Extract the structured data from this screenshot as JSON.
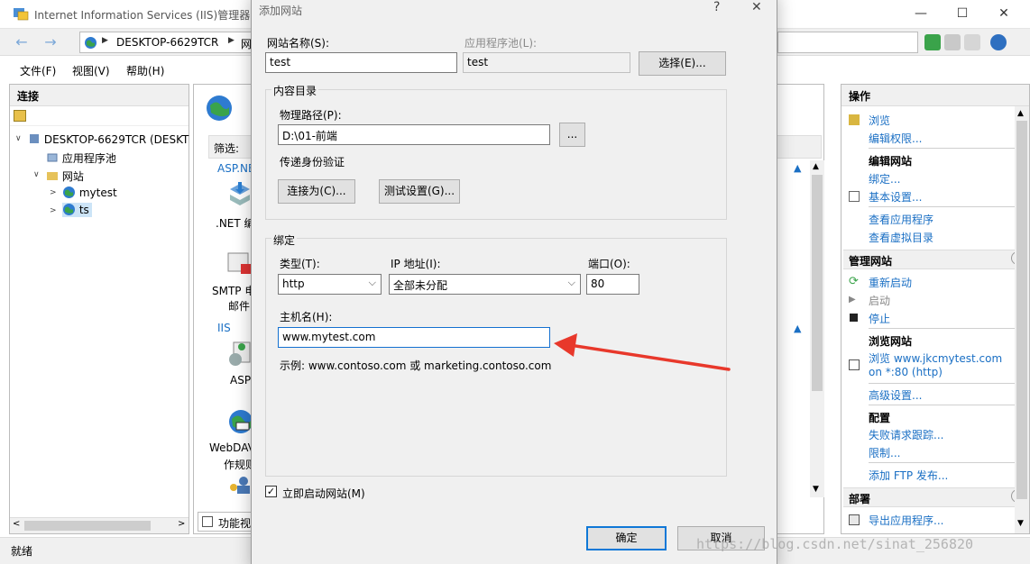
{
  "window": {
    "title": "Internet Information Services (IIS)管理器",
    "minimize": "—",
    "maximize": "☐",
    "close": "✕"
  },
  "address": {
    "back": "←",
    "forward": "→",
    "crumb_host": "DESKTOP-6629TCR",
    "crumb_sep": "▶",
    "crumb_next": "网"
  },
  "menu": {
    "file": "文件(F)",
    "view": "视图(V)",
    "help": "帮助(H)"
  },
  "connections": {
    "header": "连接",
    "tree": [
      {
        "label": "DESKTOP-6629TCR (DESKT",
        "twisty": "∨"
      },
      {
        "label": "应用程序池",
        "twisty": ""
      },
      {
        "label": "网站",
        "twisty": "∨"
      },
      {
        "label": "mytest",
        "twisty": ">"
      },
      {
        "label": "ts",
        "twisty": ">"
      }
    ]
  },
  "center": {
    "filter_label": "筛选:",
    "group_asp": "ASP.NE",
    "item_net": ".NET 编",
    "item_smtp": "SMTP 电",
    "item_smtp2": "邮件",
    "group_iis": "IIS",
    "item_asp": "ASP",
    "item_webdav": "WebDAV",
    "item_webdav2": "作规则",
    "bottom_tab": "功能视"
  },
  "actions": {
    "header": "操作",
    "browse": "浏览",
    "edit_perms": "编辑权限...",
    "edit_site": "编辑网站",
    "bindings": "绑定...",
    "basic_settings": "基本设置...",
    "view_apps": "查看应用程序",
    "view_vdirs": "查看虚拟目录",
    "manage_site": "管理网站",
    "restart": "重新启动",
    "start": "启动",
    "stop": "停止",
    "browse_site": "浏览网站",
    "browse_url": "浏览 www.jkcmytest.com",
    "browse_port": "on *:80 (http)",
    "advanced": "高级设置...",
    "config": "配置",
    "failed_trace": "失败请求跟踪...",
    "limits": "限制...",
    "add_ftp": "添加 FTP 发布...",
    "deploy": "部署",
    "export_app": "导出应用程序...",
    "collapse": "⌃"
  },
  "dialog": {
    "title": "添加网站",
    "help": "?",
    "close": "✕",
    "site_name_label": "网站名称(S):",
    "site_name_value": "test",
    "app_pool_label": "应用程序池(L):",
    "app_pool_value": "test",
    "select_button": "选择(E)...",
    "content_dir_title": "内容目录",
    "physical_path_label": "物理路径(P):",
    "physical_path_value": "D:\\01-前端",
    "browse_button": "...",
    "pass_through_label": "传递身份验证",
    "connect_as_button": "连接为(C)...",
    "test_settings_button": "测试设置(G)...",
    "binding_title": "绑定",
    "type_label": "类型(T):",
    "type_value": "http",
    "ip_label": "IP 地址(I):",
    "ip_value": "全部未分配",
    "port_label": "端口(O):",
    "port_value": "80",
    "host_label": "主机名(H):",
    "host_value": "www.mytest.com",
    "example_text": "示例: www.contoso.com 或 marketing.contoso.com",
    "start_now_label": "立即启动网站(M)",
    "start_now_checked": "✓",
    "ok_button": "确定",
    "cancel_button": "取消"
  },
  "status": {
    "text": "就绪"
  },
  "watermark": "https://blog.csdn.net/sinat_256820",
  "colors": {
    "accent": "#0f78d7",
    "link": "#1a6fc4",
    "arrow": "#e8382b"
  }
}
